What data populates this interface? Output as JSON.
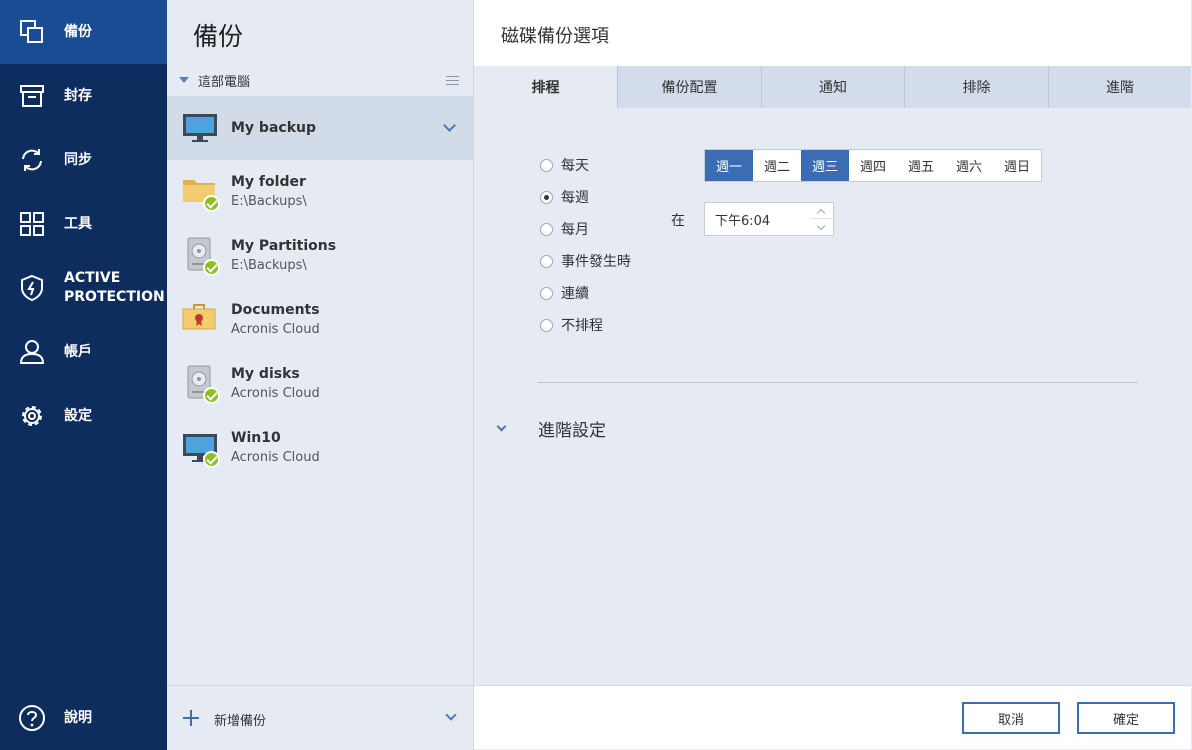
{
  "sidebar": {
    "items": [
      {
        "label": "備份",
        "icon": "backup-icon",
        "active": true
      },
      {
        "label": "封存",
        "icon": "archive-icon"
      },
      {
        "label": "同步",
        "icon": "sync-icon"
      },
      {
        "label": "工具",
        "icon": "tools-icon"
      },
      {
        "label": "ACTIVE PROTECTION",
        "icon": "shield-icon"
      },
      {
        "label": "帳戶",
        "icon": "account-icon"
      },
      {
        "label": "設定",
        "icon": "gear-icon"
      }
    ],
    "help_label": "說明"
  },
  "backups": {
    "title": "備份",
    "group_label": "這部電腦",
    "items": [
      {
        "name": "My backup",
        "sub": "",
        "icon": "monitor-icon",
        "selected": true
      },
      {
        "name": "My folder",
        "sub": "E:\\Backups\\",
        "icon": "folder-icon"
      },
      {
        "name": "My Partitions",
        "sub": "E:\\Backups\\",
        "icon": "hard-drive-icon"
      },
      {
        "name": "Documents",
        "sub": "Acronis Cloud",
        "icon": "briefcase-icon"
      },
      {
        "name": "My disks",
        "sub": "Acronis Cloud",
        "icon": "hard-drive-icon"
      },
      {
        "name": "Win10",
        "sub": "Acronis Cloud",
        "icon": "monitor-icon"
      }
    ],
    "add_label": "新增備份"
  },
  "options": {
    "title": "磁碟備份選項",
    "tabs": [
      "排程",
      "備份配置",
      "通知",
      "排除",
      "進階"
    ],
    "active_tab": "排程",
    "schedule_options": [
      "每天",
      "每週",
      "每月",
      "事件發生時",
      "連續",
      "不排程"
    ],
    "selected_option": "每週",
    "days": [
      "週一",
      "週二",
      "週三",
      "週四",
      "週五",
      "週六",
      "週日"
    ],
    "selected_days": [
      "週一",
      "週三"
    ],
    "at_label": "在",
    "time_value": "下午6:04",
    "advanced_label": "進階設定",
    "cancel_label": "取消",
    "ok_label": "確定"
  },
  "colors": {
    "nav_background": "#0d2d5e",
    "nav_active": "#1a4c93",
    "accent": "#3a6db1",
    "check_green": "#8bbf28"
  }
}
